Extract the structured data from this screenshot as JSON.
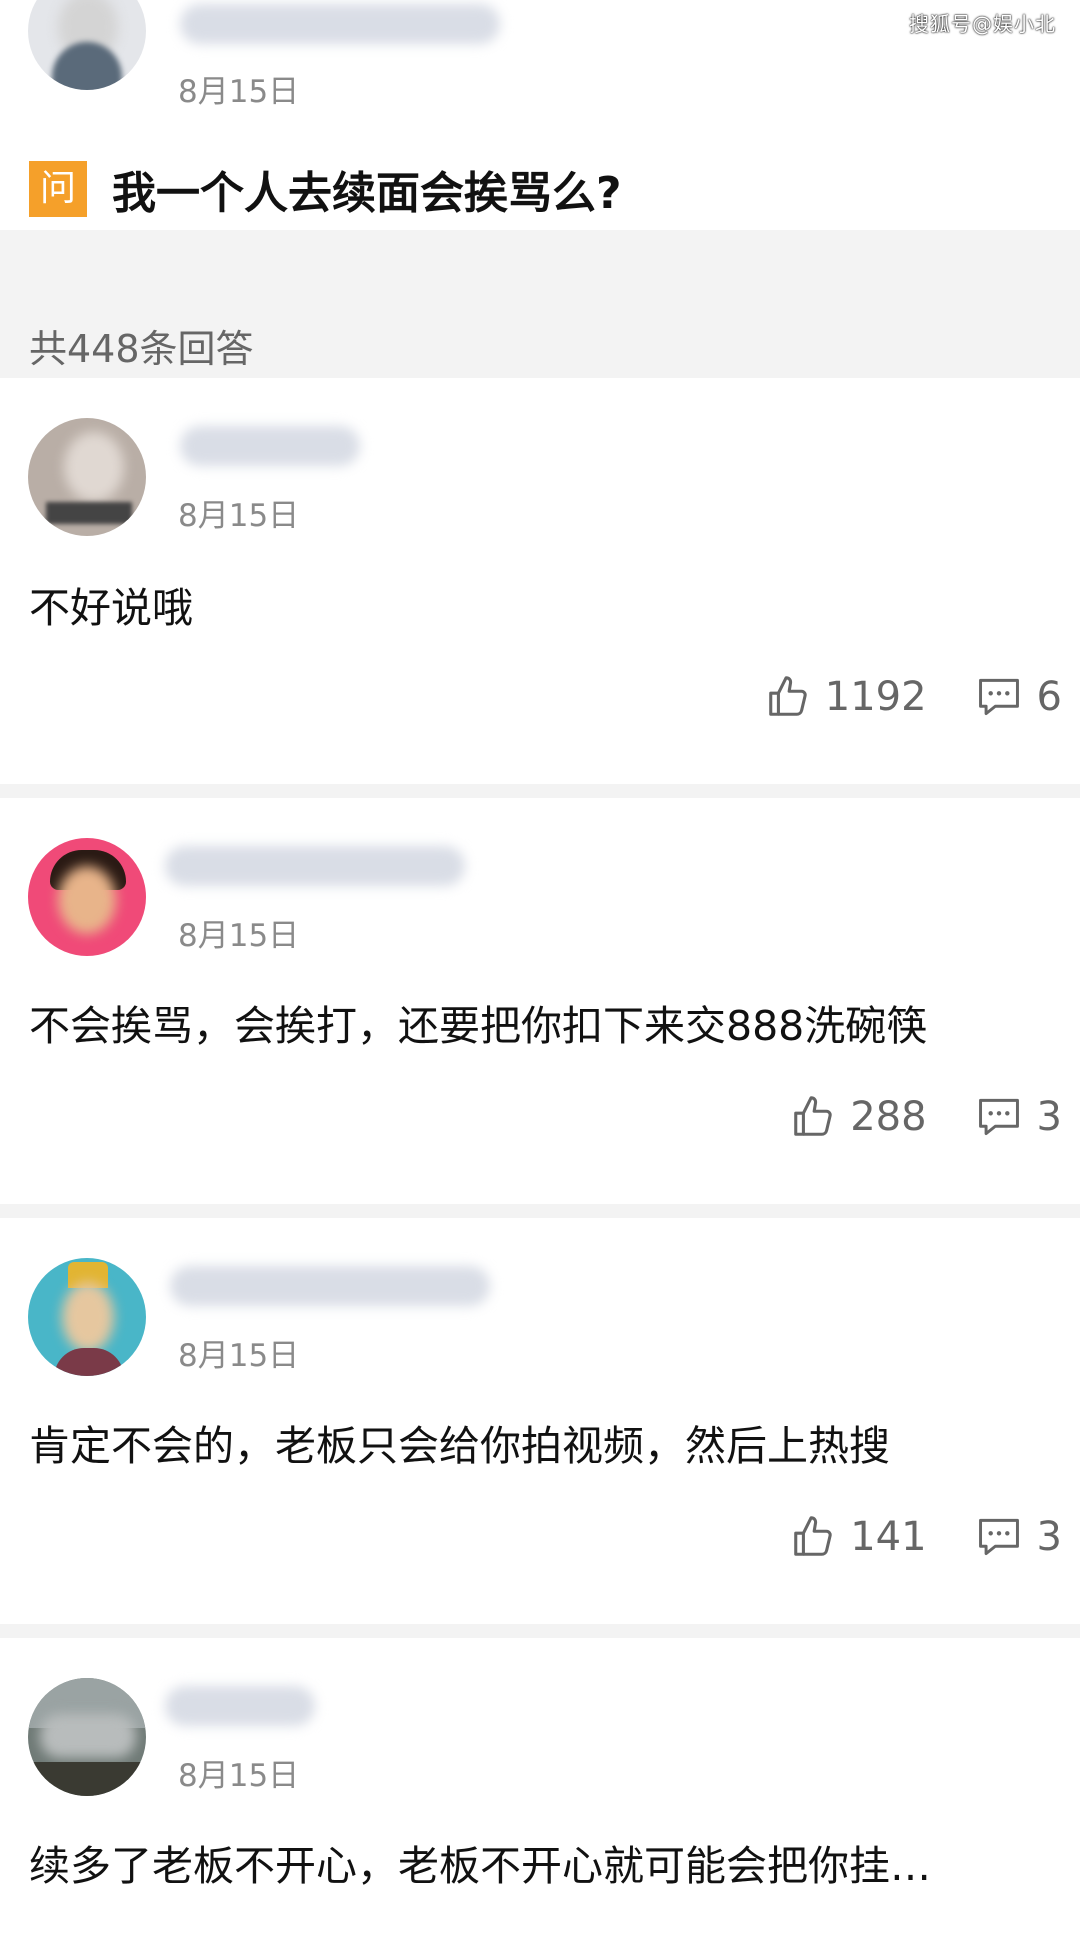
{
  "watermark": "搜狐号@娱小北",
  "question": {
    "date": "8月15日",
    "icon_label": "问",
    "title": "我一个人去续面会挨骂么?"
  },
  "answers_count_text": "共448条回答",
  "answers": [
    {
      "date": "8月15日",
      "text": "不好说哦",
      "likes": "1192",
      "comments": "6"
    },
    {
      "date": "8月15日",
      "text": "不会挨骂，会挨打，还要把你扣下来交888洗碗筷",
      "likes": "288",
      "comments": "3"
    },
    {
      "date": "8月15日",
      "text": "肯定不会的，老板只会给你拍视频，然后上热搜",
      "likes": "141",
      "comments": "3"
    },
    {
      "date": "8月15日",
      "text": "续多了老板不开心，老板不开心就可能会把你挂…"
    }
  ],
  "colors": {
    "question_icon": "#f5a02a",
    "separator": "#f3f3f3",
    "meta_text": "#8a8a8a",
    "stat_text": "#666666"
  },
  "icons": {
    "like": "thumbs-up-icon",
    "comment": "comment-bubble-icon"
  }
}
